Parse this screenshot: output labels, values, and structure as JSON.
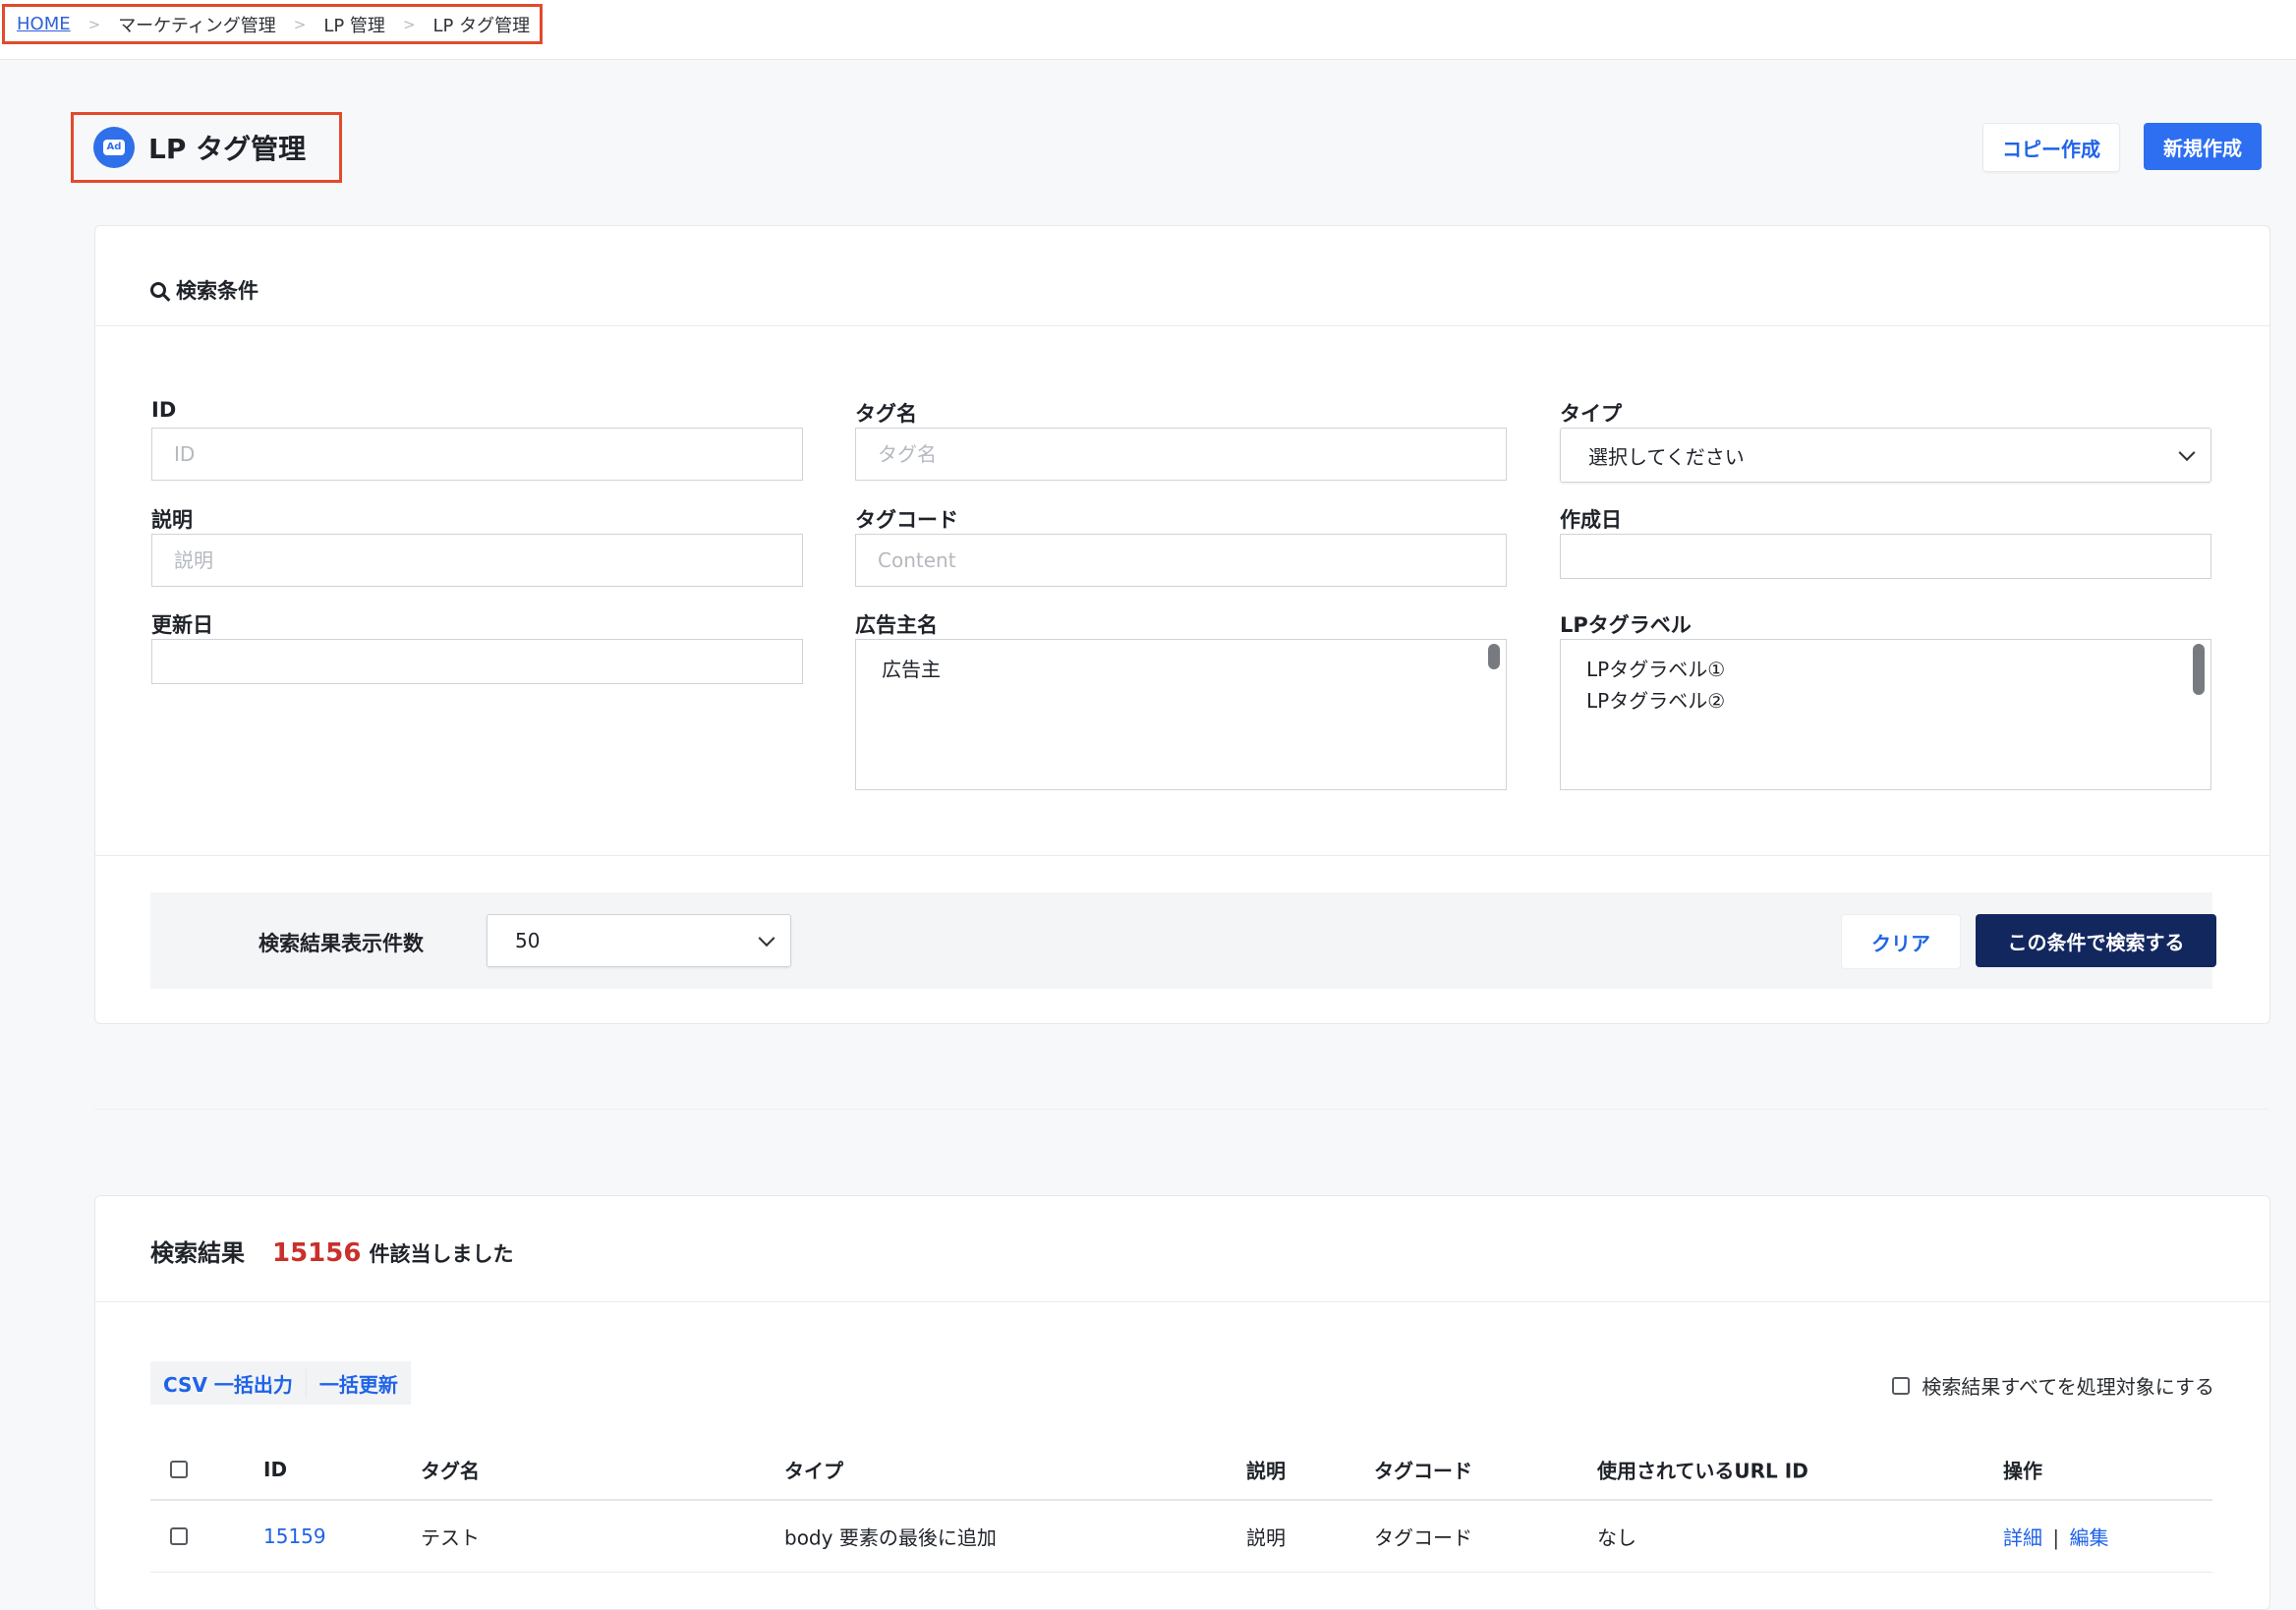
{
  "breadcrumb": {
    "home": "HOME",
    "sep": ">",
    "item1": "マーケティング管理",
    "item2": "LP 管理",
    "item3": "LP タグ管理"
  },
  "page": {
    "title": "LP タグ管理",
    "icon_text": "Ad",
    "copy_button": "コピー作成",
    "new_button": "新規作成"
  },
  "search": {
    "title": "検索条件",
    "fields": {
      "id": {
        "label": "ID",
        "placeholder": "ID"
      },
      "tag_name": {
        "label": "タグ名",
        "placeholder": "タグ名"
      },
      "type": {
        "label": "タイプ",
        "value": "選択してください"
      },
      "description": {
        "label": "説明",
        "placeholder": "説明"
      },
      "tag_code": {
        "label": "タグコード",
        "placeholder": "Content"
      },
      "created": {
        "label": "作成日"
      },
      "updated": {
        "label": "更新日"
      },
      "advertiser": {
        "label": "広告主名",
        "options": [
          "広告主"
        ]
      },
      "lp_label": {
        "label": "LPタグラベル",
        "options": [
          "LPタグラベル①",
          "LPタグラベル②"
        ]
      }
    },
    "display_count_label": "検索結果表示件数",
    "display_count_value": "50",
    "clear_button": "クリア",
    "search_button": "この条件で検索する"
  },
  "results": {
    "title": "検索結果",
    "count": "15156",
    "count_suffix": "件該当しました",
    "csv_button": "CSV 一括出力",
    "bulk_update_button": "一括更新",
    "all_target_label": "検索結果すべてを処理対象にする",
    "columns": [
      "ID",
      "タグ名",
      "タイプ",
      "説明",
      "タグコード",
      "使用されているURL ID",
      "操作"
    ],
    "rows": [
      {
        "id": "15159",
        "tag_name": "テスト",
        "type": "body 要素の最後に追加",
        "description": "説明",
        "tag_code": "タグコード",
        "url_id": "なし",
        "detail": "詳細",
        "divider": "|",
        "edit": "編集"
      }
    ]
  },
  "colors": {
    "accent": "#2d6ff0",
    "primary_dark": "#13275f",
    "highlight_border": "#e24a2c",
    "count_red": "#c9302c"
  }
}
